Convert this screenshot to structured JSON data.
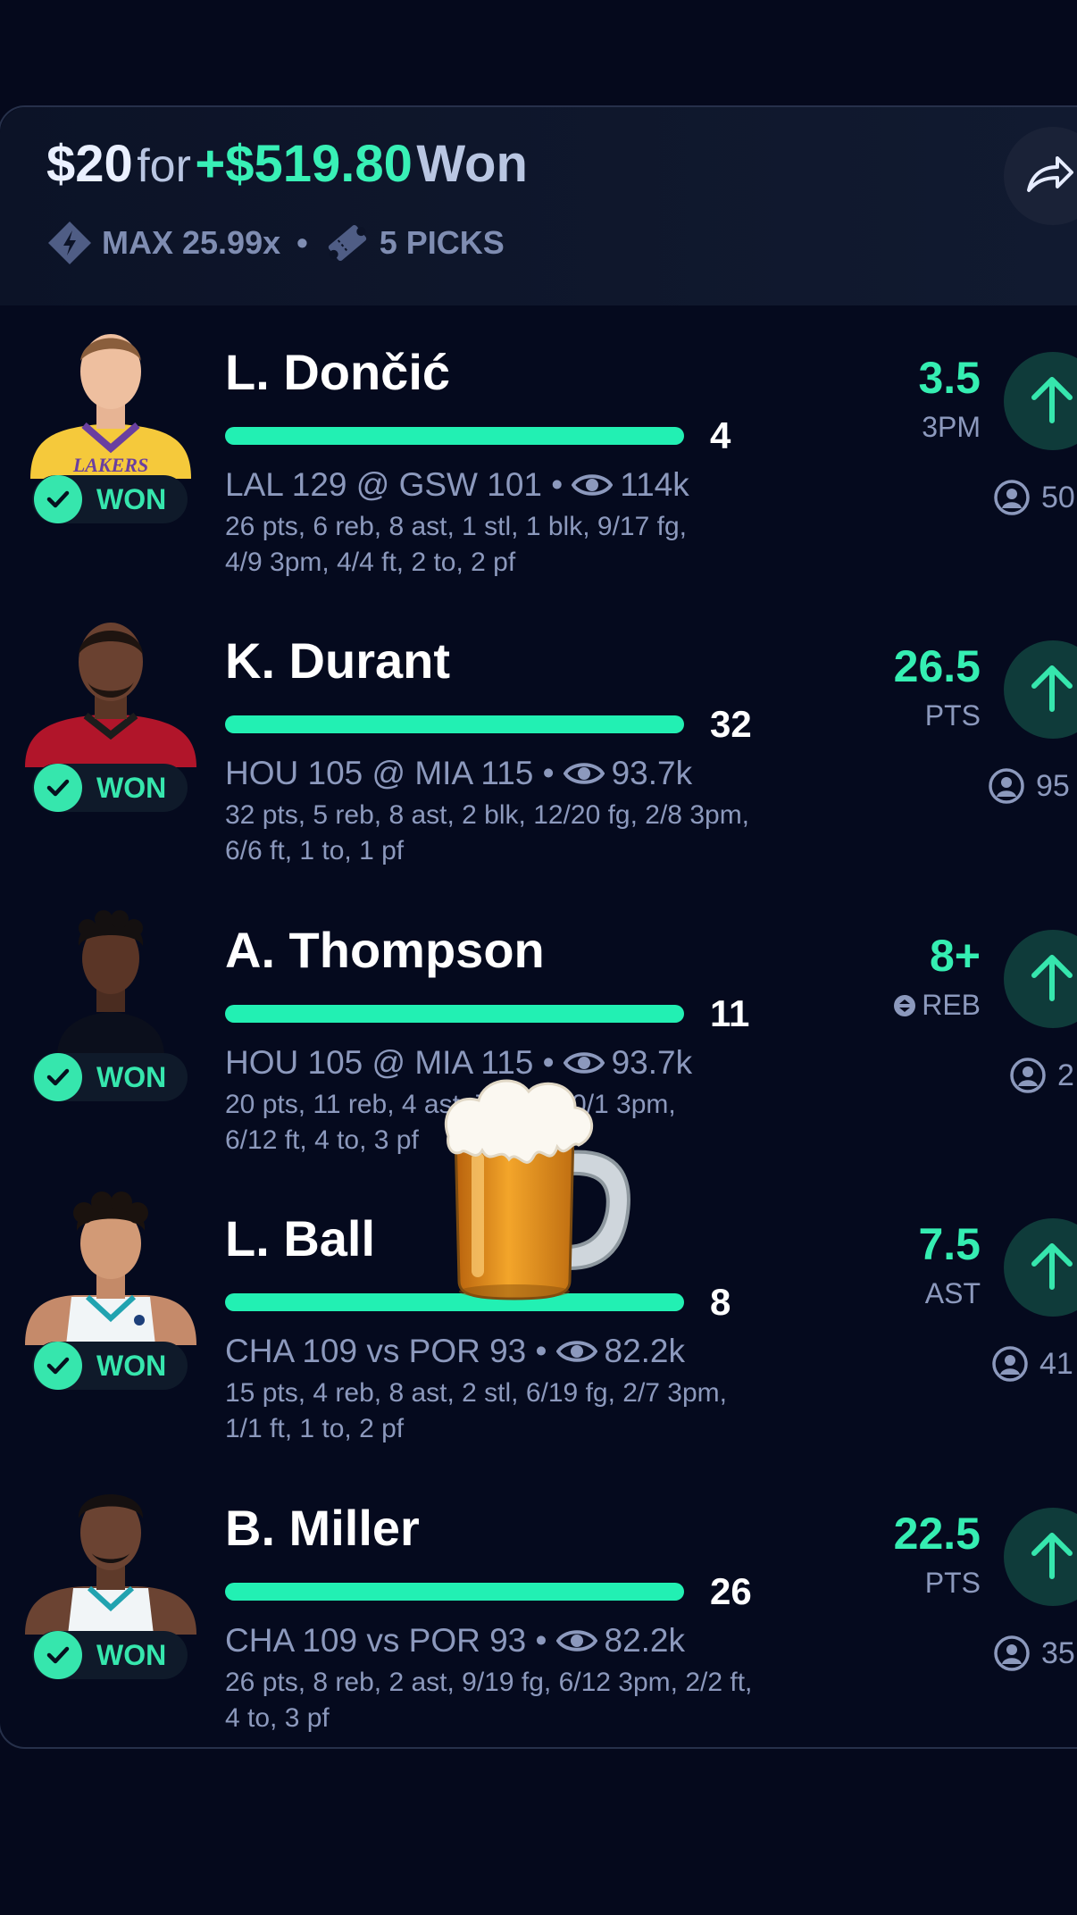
{
  "header": {
    "stake": "$20",
    "for": "for",
    "winnings": "+$519.80",
    "status": "Won",
    "multiplier": "MAX 25.99x",
    "separator": "•",
    "picks": "5 PICKS"
  },
  "picks": [
    {
      "player": "L. Dončić",
      "result": "4",
      "game": "LAL 129 @ GSW 101 •",
      "views": "114k",
      "box1": "26 pts, 6 reb, 8 ast, 1 stl, 1 blk, 9/17 fg,",
      "box2": "4/9 3pm, 4/4 ft, 2 to, 2 pf",
      "line": "3.5",
      "stat_type": "3PM",
      "users": "50",
      "badge": "WON"
    },
    {
      "player": "K. Durant",
      "result": "32",
      "game": "HOU 105 @ MIA 115 •",
      "views": "93.7k",
      "box1": "32 pts, 5 reb, 8 ast, 2 blk, 12/20 fg, 2/8 3pm,",
      "box2": "6/6 ft, 1 to, 1 pf",
      "line": "26.5",
      "stat_type": "PTS",
      "users": "95",
      "badge": "WON"
    },
    {
      "player": "A. Thompson",
      "result": "11",
      "game": "HOU 105 @ MIA 115 •",
      "views": "93.7k",
      "box1": "20 pts, 11 reb, 4 ast, 7/16 fg, 0/1 3pm,",
      "box2": "6/12 ft, 4 to, 3 pf",
      "line": "8+",
      "stat_type": "REB",
      "users": "2",
      "badge": "WON"
    },
    {
      "player": "L. Ball",
      "result": "8",
      "game": "CHA 109 vs POR 93 •",
      "views": "82.2k",
      "box1": "15 pts, 4 reb, 8 ast, 2 stl, 6/19 fg, 2/7 3pm,",
      "box2": "1/1 ft, 1 to, 2 pf",
      "line": "7.5",
      "stat_type": "AST",
      "users": "41",
      "badge": "WON"
    },
    {
      "player": "B. Miller",
      "result": "26",
      "game": "CHA 109 vs POR 93 •",
      "views": "82.2k",
      "box1": "26 pts, 8 reb, 2 ast, 9/19 fg, 6/12 3pm, 2/2 ft,",
      "box2": "4 to, 3 pf",
      "line": "22.5",
      "stat_type": "PTS",
      "users": "35",
      "badge": "WON"
    }
  ],
  "colors": {
    "accent": "#36e6ad",
    "background": "#05091c",
    "muted_text": "#8c99bd"
  },
  "icons": [
    "diamond-multiplier-icon",
    "ticket-icon",
    "share-icon",
    "check-icon",
    "eye-icon",
    "arrow-up-icon",
    "user-icon",
    "beer-mug-icon"
  ]
}
